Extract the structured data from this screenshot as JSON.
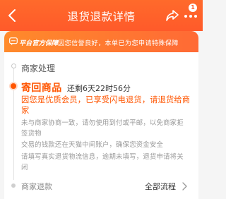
{
  "header": {
    "title": "退货退款详情",
    "badge_count": "1",
    "background_color": "#ff5a2a"
  },
  "notice": {
    "tag": "平台官方保障",
    "text": "因您信誉良好，本单已为您申请特殊保障"
  },
  "timeline": {
    "done_step": "商家处理",
    "active_step": {
      "title": "寄回商品",
      "countdown": "还剩6天22时56分",
      "highlight": "因您是优质会员，已享受闪电退货，请退货给商家",
      "desc_lines": [
        "未与商家协商一致，请勿使用到付或平邮，以免商家拒签货物",
        "交易的钱款还在天猫中间账户，确保您资金安全",
        "请填写真实退货物流信息，逾期未填写，退货申请将关闭"
      ]
    },
    "next_step": "商家退款",
    "all_flow_label": "全部流程"
  },
  "colors": {
    "accent": "#ff5500",
    "notice_bg": "#ff7a2e"
  }
}
